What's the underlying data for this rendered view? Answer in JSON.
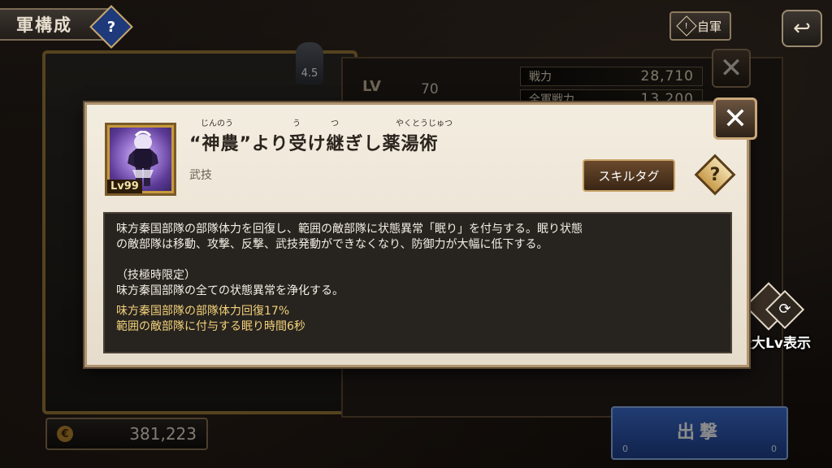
{
  "header": {
    "title": "軍構成",
    "help_label": "?",
    "own_army_label": "自軍",
    "own_army_icon_text": "!",
    "back_icon": "↩"
  },
  "background": {
    "lv_label": "LV",
    "lv_value": "70",
    "rating": "4.5",
    "stats": [
      {
        "label": "戦力",
        "value": "28,710"
      },
      {
        "label": "全軍戦力",
        "value": "13,200"
      }
    ],
    "close_icon": "✕",
    "money_icon": "€",
    "money": "381,223",
    "sortie_label": "出撃",
    "sortie_left": "0",
    "sortie_right": "0"
  },
  "side": {
    "max_lv_label": "最大Lv表示",
    "refresh_icon": "⟳"
  },
  "modal": {
    "skill_level": "Lv99",
    "skill_name": "“神農”より受け継ぎし薬湯術",
    "ruby": [
      {
        "text": "じんのう"
      },
      {
        "text": "う"
      },
      {
        "text": "つ"
      },
      {
        "text": "やくとうじゅつ"
      }
    ],
    "skill_type": "武技",
    "tag_button": "スキルタグ",
    "help_label": "?",
    "close_icon": "✕",
    "description": [
      "味方秦国部隊の部隊体力を回復し、範囲の敵部隊に状態異常「眠り」を付与する。眠り状態",
      "の敵部隊は移動、攻撃、反撃、武技発動ができなくなり、防御力が大幅に低下する。"
    ],
    "extreme_title": "（技極時限定）",
    "extreme_text": "味方秦国部隊の全ての状態異常を浄化する。",
    "effects": [
      "味方秦国部隊の部隊体力回復17%",
      "範囲の敵部隊に付与する眠り時間6秒"
    ]
  },
  "colors": {
    "modal_bg": "#f0e9dc",
    "desc_bg": "#27231f",
    "highlight": "#f3d27a",
    "sortie": "#2f5cc0"
  }
}
